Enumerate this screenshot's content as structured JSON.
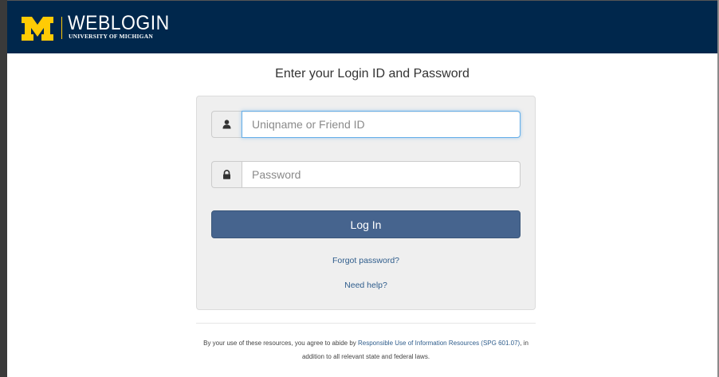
{
  "header": {
    "logo_letter": "M",
    "title": "WEBLOGIN",
    "subtitle": "UNIVERSITY OF MICHIGAN",
    "background_color": "#00274c",
    "accent_color": "#ffcb05"
  },
  "main": {
    "heading": "Enter your Login ID and Password"
  },
  "form": {
    "username": {
      "icon": "user-icon",
      "placeholder": "Uniqname or Friend ID",
      "value": ""
    },
    "password": {
      "icon": "lock-icon",
      "placeholder": "Password",
      "value": ""
    },
    "login_label": "Log In",
    "login_color": "#46648e",
    "forgot_link": "Forgot password?",
    "help_link": "Need help?"
  },
  "footer": {
    "prefix": "By your use of these resources, you agree to abide by ",
    "policy_link": "Responsible Use of Information Resources (SPG 601.07)",
    "suffix": ", in addition to all relevant state and federal laws."
  }
}
